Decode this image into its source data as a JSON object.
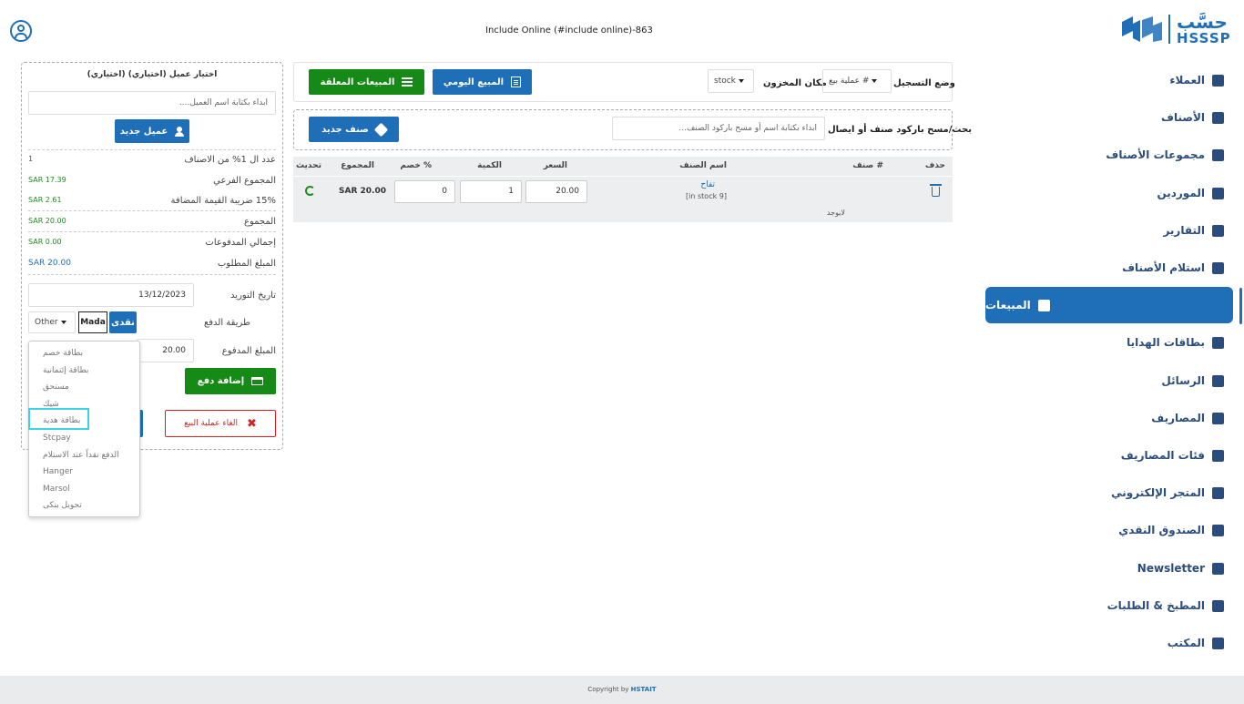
{
  "header": {
    "store_title": "Include Online (#include online)-863"
  },
  "logo": {
    "arabic_text": "حسَّب",
    "english_text": "HSSSP"
  },
  "sidebar": {
    "items": [
      {
        "label": "العملاء",
        "icon": "users-icon"
      },
      {
        "label": "الأصناف",
        "icon": "box-icon"
      },
      {
        "label": "مجموعات الأصناف",
        "icon": "layers-icon"
      },
      {
        "label": "الموردين",
        "icon": "supplier-icon"
      },
      {
        "label": "التقارير",
        "icon": "chart-icon"
      },
      {
        "label": "استلام الأصناف",
        "icon": "receive-icon"
      },
      {
        "label": "المبيعات",
        "icon": "sales-icon",
        "active": true
      },
      {
        "label": "بطاقات الهدايا",
        "icon": "gift-icon"
      },
      {
        "label": "الرسائل",
        "icon": "message-icon"
      },
      {
        "label": "المصاريف",
        "icon": "expenses-icon"
      },
      {
        "label": "فئات المصاريف",
        "icon": "expense-categories-icon"
      },
      {
        "label": "المتجر الإلكتروني",
        "icon": "store-icon"
      },
      {
        "label": "الصندوق النقدي",
        "icon": "cash-box-icon"
      },
      {
        "label": "Newsletter",
        "icon": "newsletter-icon"
      },
      {
        "label": "المطبخ & الطلبات",
        "icon": "kitchen-icon"
      },
      {
        "label": "المكتب",
        "icon": "office-icon"
      }
    ]
  },
  "toolbar": {
    "suspended_sales_label": "المبيعات المعلقة",
    "daily_sales_label": "المبيع اليومي",
    "warehouse_label": "مكان المخزون",
    "warehouse_value": "stock",
    "register_mode_label": "وضع التسجيل",
    "register_mode_value": "عملية بيع #"
  },
  "search": {
    "label": "بحث/مسح باركود صنف أو ايصال",
    "placeholder": "ابداء بكتابة اسم أو مسح باركود الصنف...",
    "new_item_label": "صنف جديد"
  },
  "table": {
    "headers": {
      "delete": "حذف",
      "item_no": "صنف #",
      "item_name": "اسم الصنف",
      "price": "السعر",
      "quantity": "الكمية",
      "discount": "خصم %",
      "total": "المجموع",
      "update": "تحديث"
    },
    "rows": [
      {
        "name": "تفاح",
        "stock": "[in stock 9]",
        "price": "20.00",
        "quantity": "1",
        "discount": "0",
        "total": "SAR 20.00",
        "note": "لايوجد"
      }
    ]
  },
  "customer": {
    "title": "اختيار عميل (اختياري) (اختياري)",
    "placeholder": "ابداء بكتابة اسم العميل....",
    "new_customer_label": "عميل جديد"
  },
  "summary": {
    "items_count_label": "عدد ال 1% من الاصناف",
    "items_count_value": "1",
    "subtotal_label": "المجموع الفرعي",
    "subtotal_value": "SAR 17.39",
    "vat_label": "15% ضريبة القيمة المضافة",
    "vat_value": "SAR 2.61",
    "total_label": "المجموع",
    "total_value": "SAR 20.00",
    "payments_label": "إجمالي المدفوعات",
    "payments_value": "SAR 0.00",
    "due_label": "المبلغ المطلوب",
    "due_value": "SAR 20.00"
  },
  "payment": {
    "delivery_date_label": "تاريخ التوريد",
    "delivery_date_value": "13/12/2023",
    "method_label": "طريقة الدفع",
    "cash_label": "نقدى",
    "mada_label": "Mada",
    "other_label": "Other",
    "amount_label": "المبلغ المدفوع",
    "amount_value": "20.00",
    "add_payment_label": "إضافة دفع",
    "cancel_sale_label": "الغاء عملية البيع"
  },
  "dropdown": {
    "options": [
      "بطاقة خصم",
      "بطاقة إئتمانية",
      "مستحق",
      "شيك",
      "بطاقة هدية",
      "Stcpay",
      "الدفع نقداً عند الاستلام",
      "Hanger",
      "Marsol",
      "تحويل بنكى"
    ],
    "highlighted": "بطاقة هدية"
  },
  "footer": {
    "copyright_prefix": "Copyright by",
    "copyright_brand": "HSTAIT"
  },
  "colors": {
    "primary": "#1e6fb8",
    "success": "#168a16",
    "danger": "#d92020",
    "highlight": "#3dd3e6"
  }
}
